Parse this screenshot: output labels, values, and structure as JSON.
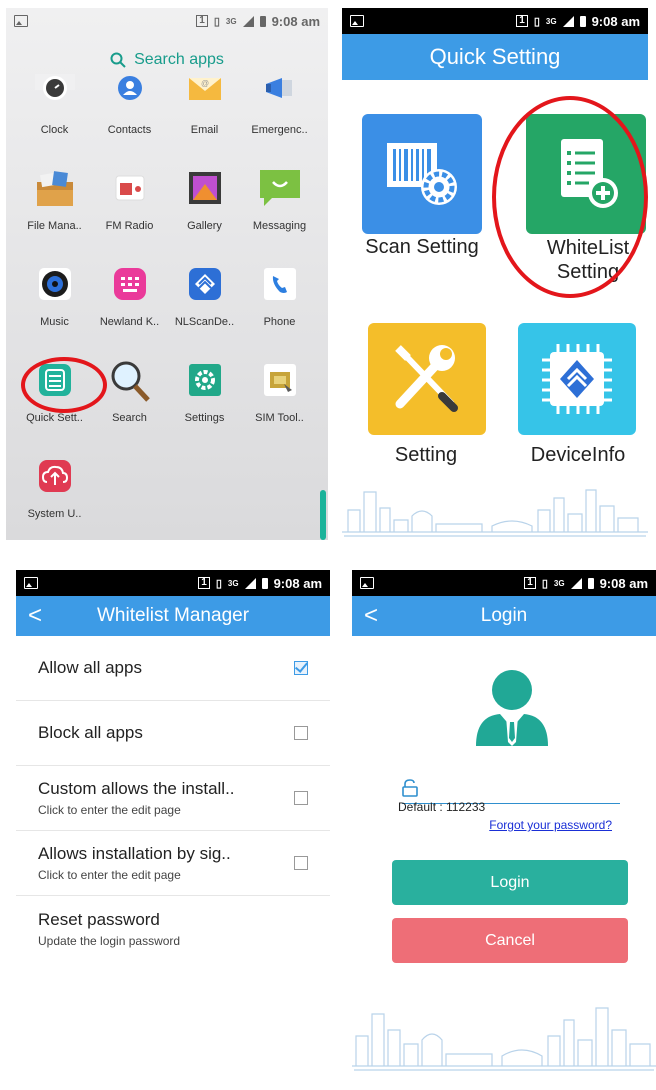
{
  "status": {
    "time": "9:08 am",
    "sim": "1",
    "net": "3G"
  },
  "drawer": {
    "search_label": "Search apps",
    "apps": [
      {
        "label": "Clock",
        "icon": "clock-icon"
      },
      {
        "label": "Contacts",
        "icon": "contacts-icon"
      },
      {
        "label": "Email",
        "icon": "email-icon"
      },
      {
        "label": "Emergenc..",
        "icon": "megaphone-icon"
      },
      {
        "label": "File Mana..",
        "icon": "file-manager-icon"
      },
      {
        "label": "FM Radio",
        "icon": "radio-icon"
      },
      {
        "label": "Gallery",
        "icon": "gallery-icon"
      },
      {
        "label": "Messaging",
        "icon": "messaging-icon"
      },
      {
        "label": "Music",
        "icon": "music-icon"
      },
      {
        "label": "Newland K..",
        "icon": "keyboard-icon"
      },
      {
        "label": "NLScanDe..",
        "icon": "nlscan-icon"
      },
      {
        "label": "Phone",
        "icon": "phone-icon"
      },
      {
        "label": "Quick Sett..",
        "icon": "quick-settings-icon"
      },
      {
        "label": "Search",
        "icon": "search-icon"
      },
      {
        "label": "Settings",
        "icon": "gear-icon"
      },
      {
        "label": "SIM Tool..",
        "icon": "sim-toolkit-icon"
      },
      {
        "label": "System U..",
        "icon": "system-update-icon"
      }
    ]
  },
  "quick_setting": {
    "title": "Quick Setting",
    "tiles": {
      "scan": "Scan Setting",
      "whitelist": "WhiteList Setting",
      "setting": "Setting",
      "deviceinfo": "DeviceInfo"
    }
  },
  "whitelist": {
    "title": "Whitelist Manager",
    "back": "<",
    "rows": [
      {
        "title": "Allow all apps",
        "sub": "",
        "checked": true
      },
      {
        "title": "Block all apps",
        "sub": "",
        "checked": false
      },
      {
        "title": "Custom allows the install..",
        "sub": "Click to enter the edit page",
        "checked": false
      },
      {
        "title": "Allows installation by sig..",
        "sub": "Click to enter the edit page",
        "checked": false
      },
      {
        "title": "Reset password",
        "sub": "Update the login password"
      }
    ]
  },
  "login": {
    "title": "Login",
    "back": "<",
    "default_text": "Default : 112233",
    "forgot": "Forgot your password?",
    "login_btn": "Login",
    "cancel_btn": "Cancel"
  },
  "colors": {
    "accent": "#3d9be6",
    "teal": "#29b09e",
    "cancel": "#ee6e77",
    "highlight": "#e3161b"
  }
}
